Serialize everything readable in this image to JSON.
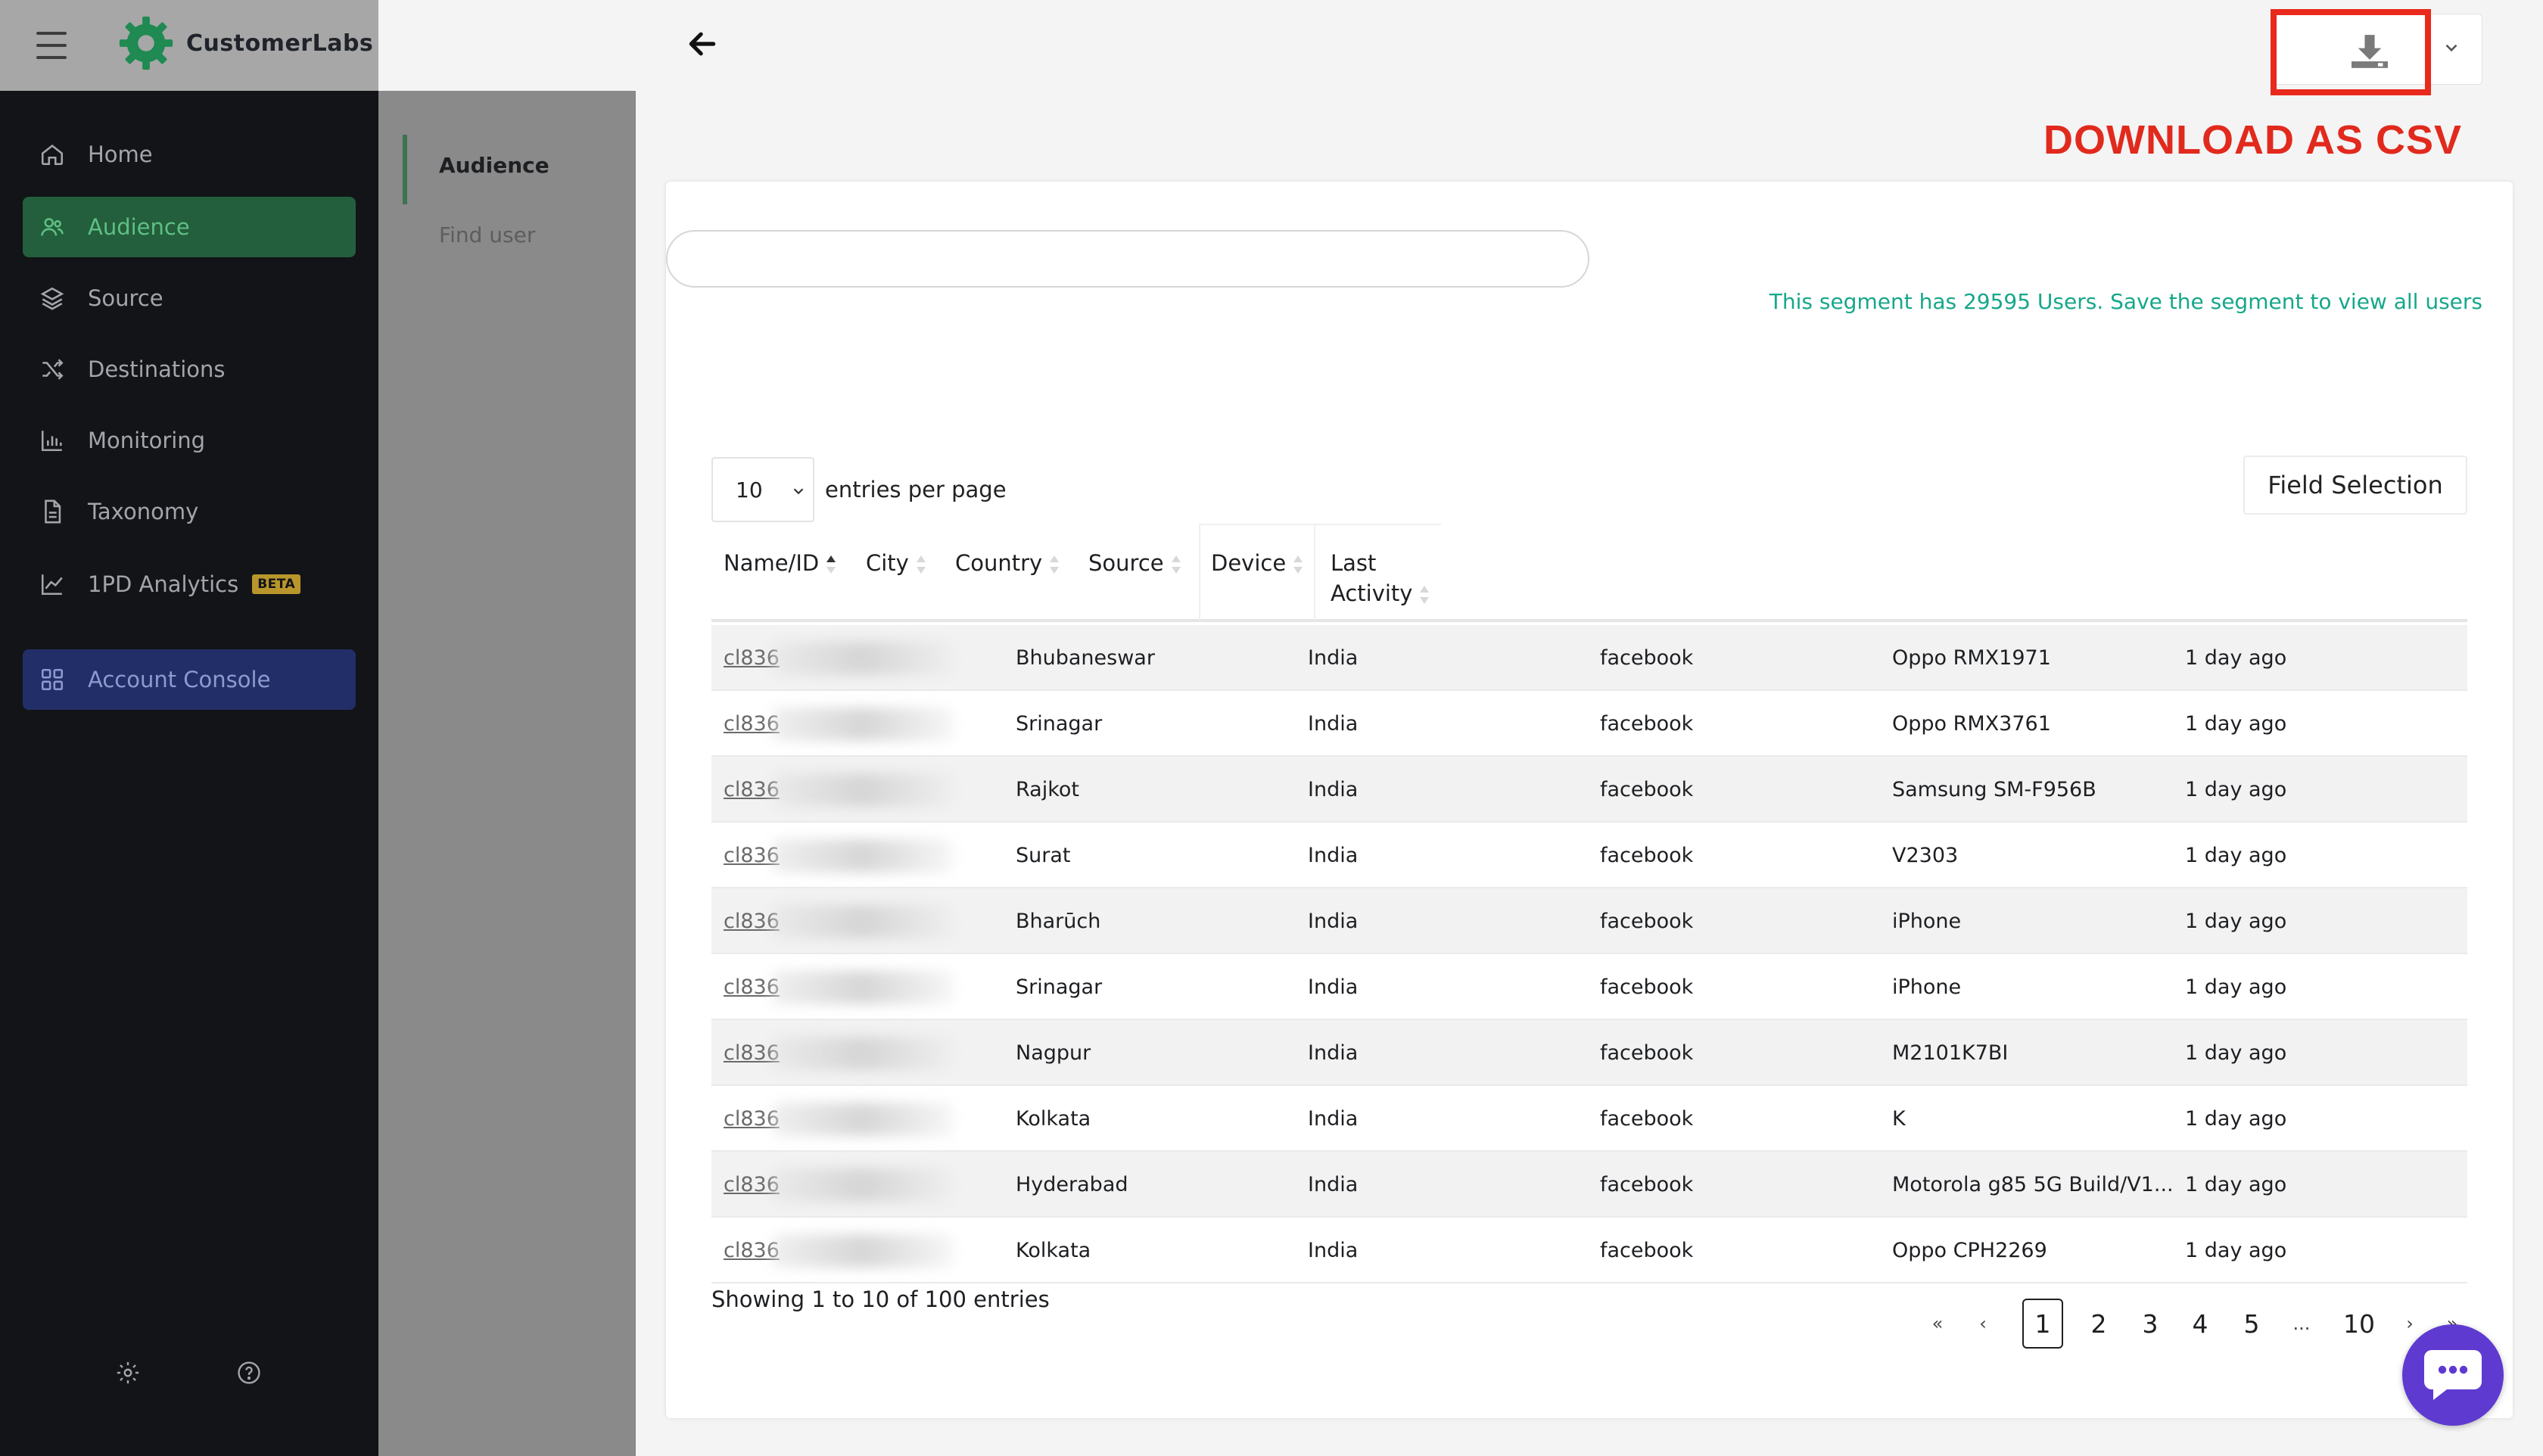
{
  "brand": {
    "name": "CustomerLabs",
    "icon": "gear-logo-icon",
    "accent": "#1f8a52"
  },
  "sidebar": {
    "items": [
      {
        "label": "Home",
        "icon": "home-icon"
      },
      {
        "label": "Audience",
        "icon": "users-icon",
        "active": true
      },
      {
        "label": "Source",
        "icon": "layers-icon"
      },
      {
        "label": "Destinations",
        "icon": "shuffle-icon"
      },
      {
        "label": "Monitoring",
        "icon": "bar-chart-icon"
      },
      {
        "label": "Taxonomy",
        "icon": "document-icon"
      },
      {
        "label": "1PD Analytics",
        "icon": "line-chart-icon",
        "badge": "BETA"
      },
      {
        "label": "Account Console",
        "icon": "grid-icon"
      }
    ],
    "footer": {
      "settings_icon": "gear-icon",
      "help_icon": "help-icon"
    }
  },
  "subnav": {
    "items": [
      "Audience",
      "Find user"
    ]
  },
  "toolbar": {
    "back_icon": "back-arrow-icon",
    "download_icon": "download-icon",
    "annotation": "DOWNLOAD AS CSV",
    "annotation_color": "#e12a1d"
  },
  "search": {
    "value": "",
    "placeholder": ""
  },
  "segment_note": "This segment has 29595 Users. Save the segment to view all users",
  "entries": {
    "value": "10",
    "label": "entries per page"
  },
  "field_selection": "Field Selection",
  "table": {
    "columns": [
      "Name/ID",
      "City",
      "Country",
      "Source",
      "Device",
      "Last",
      "Activity"
    ],
    "rows": [
      {
        "id": "cl836",
        "city": "Bhubaneswar",
        "country": "India",
        "source": "facebook",
        "device": "Oppo RMX1971",
        "last": "1 day ago"
      },
      {
        "id": "cl836",
        "city": "Srinagar",
        "country": "India",
        "source": "facebook",
        "device": "Oppo RMX3761",
        "last": "1 day ago"
      },
      {
        "id": "cl836",
        "city": "Rajkot",
        "country": "India",
        "source": "facebook",
        "device": "Samsung SM-F956B",
        "last": "1 day ago"
      },
      {
        "id": "cl836",
        "city": "Surat",
        "country": "India",
        "source": "facebook",
        "device": "V2303",
        "last": "1 day ago"
      },
      {
        "id": "cl836",
        "city": "Bharūch",
        "country": "India",
        "source": "facebook",
        "device": "iPhone",
        "last": "1 day ago"
      },
      {
        "id": "cl836",
        "city": "Srinagar",
        "country": "India",
        "source": "facebook",
        "device": "iPhone",
        "last": "1 day ago"
      },
      {
        "id": "cl836",
        "city": "Nagpur",
        "country": "India",
        "source": "facebook",
        "device": "M2101K7BI",
        "last": "1 day ago"
      },
      {
        "id": "cl836",
        "city": "Kolkata",
        "country": "India",
        "source": "facebook",
        "device": "K",
        "last": "1 day ago"
      },
      {
        "id": "cl836",
        "city": "Hyderabad",
        "country": "India",
        "source": "facebook",
        "device": "Motorola g85 5G Build/V1...",
        "last": "1 day ago"
      },
      {
        "id": "cl836",
        "city": "Kolkata",
        "country": "India",
        "source": "facebook",
        "device": "Oppo CPH2269",
        "last": "1 day ago"
      }
    ]
  },
  "showing": "Showing 1 to 10 of 100 entries",
  "pagination": {
    "first": "«",
    "prev": "‹",
    "pages": [
      "1",
      "2",
      "3",
      "4",
      "5",
      "...",
      "10"
    ],
    "current": "1",
    "next": "›",
    "last": "»"
  },
  "chat": {
    "icon": "chat-bubble-icon",
    "color": "#5e3ad0"
  }
}
